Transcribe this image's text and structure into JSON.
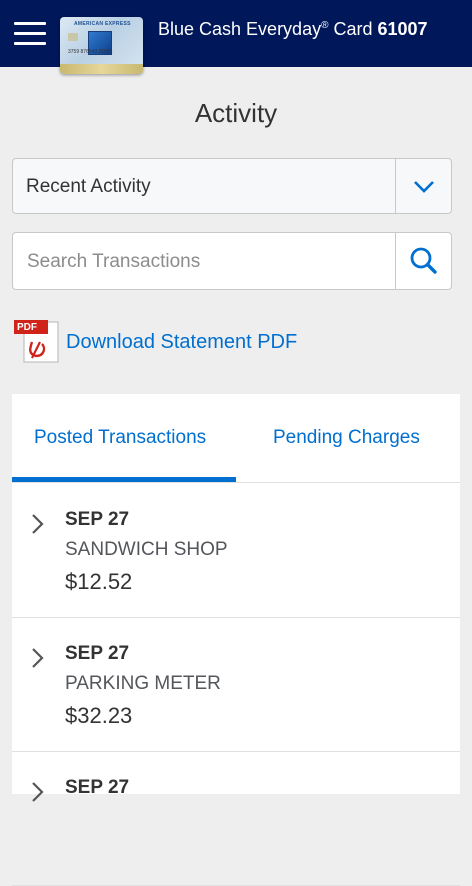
{
  "header": {
    "card_name": "Blue Cash Everyday",
    "reg_mark": "®",
    "card_word": " Card ",
    "card_last": "61007",
    "background_color": "#00175a",
    "menu_icon": "hamburger-menu-icon",
    "card_image": {
      "brand": "AMERICAN EXPRESS",
      "number": "3759 876543 21001"
    }
  },
  "page": {
    "title": "Activity"
  },
  "filter": {
    "selected": "Recent Activity",
    "icon": "chevron-down-icon"
  },
  "search": {
    "placeholder": "Search Transactions",
    "value": "",
    "icon": "search-icon"
  },
  "download": {
    "label": "Download Statement PDF",
    "icon": "pdf-icon",
    "icon_text": "PDF"
  },
  "tabs": [
    {
      "label": "Posted Transactions",
      "active": true
    },
    {
      "label": "Pending Charges",
      "active": false
    }
  ],
  "transactions": [
    {
      "date": "SEP 27",
      "merchant": "SANDWICH SHOP",
      "amount": "$12.52"
    },
    {
      "date": "SEP 27",
      "merchant": "PARKING METER",
      "amount": "$32.23"
    },
    {
      "date": "SEP 27",
      "merchant": "",
      "amount": ""
    }
  ],
  "colors": {
    "accent": "#006fcf",
    "header": "#00175a",
    "background": "#eeeeee"
  }
}
